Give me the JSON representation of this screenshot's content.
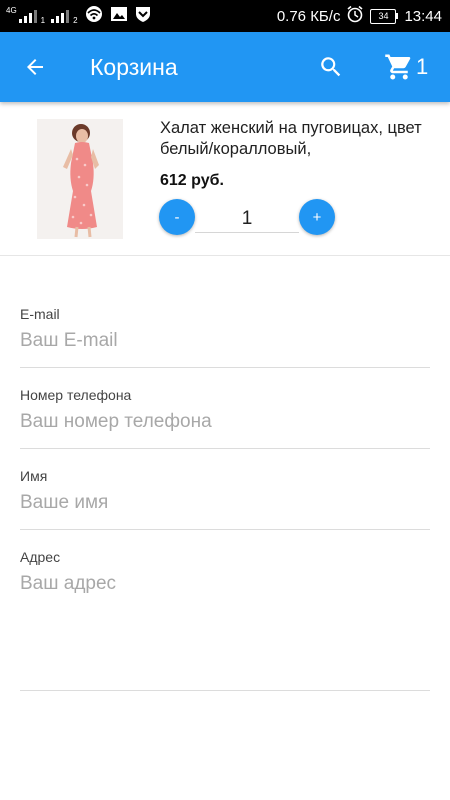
{
  "status_bar": {
    "network_label": "4G",
    "sim1_sub": "1",
    "sim2_sub": "2",
    "speed": "0.76 КБ/с",
    "battery": "34",
    "time": "13:44"
  },
  "toolbar": {
    "title": "Корзина",
    "cart_count": "1",
    "accent_color": "#2196F3"
  },
  "cart_item": {
    "title": "Халат женский на пуговицах, цвет белый/коралловый,",
    "price": "612 руб.",
    "minus_label": "-",
    "plus_label": "+",
    "quantity": "1"
  },
  "form": {
    "email": {
      "label": "E-mail",
      "placeholder": "Ваш E-mail",
      "value": ""
    },
    "phone": {
      "label": "Номер телефона",
      "placeholder": "Ваш номер телефона",
      "value": ""
    },
    "name": {
      "label": "Имя",
      "placeholder": "Ваше имя",
      "value": ""
    },
    "address": {
      "label": "Адрес",
      "placeholder": "Ваш адрес",
      "value": ""
    }
  },
  "icons": [
    "arrow-left-icon",
    "search-icon",
    "cart-icon",
    "wifi-icon",
    "image-icon",
    "shield-icon",
    "alarm-icon",
    "battery-icon"
  ]
}
